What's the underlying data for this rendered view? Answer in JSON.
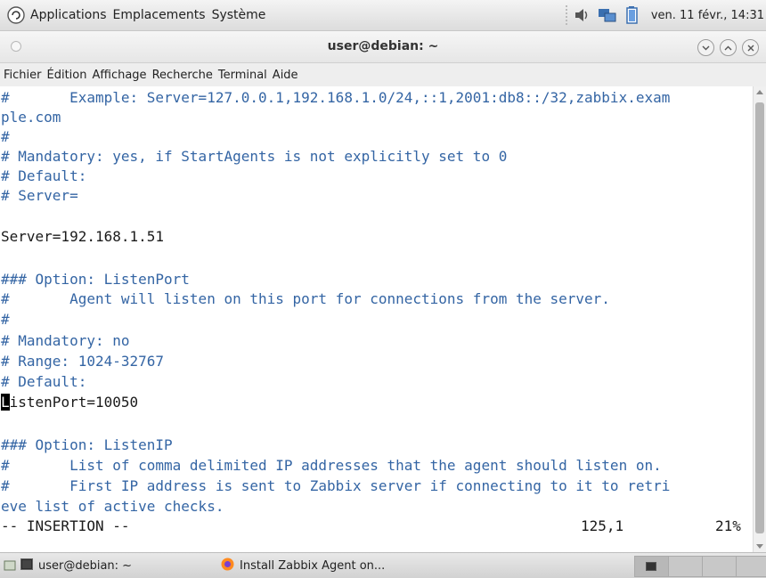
{
  "top_panel": {
    "menu": [
      "Applications",
      "Emplacements",
      "Système"
    ],
    "clock": "ven. 11 févr., 14:31"
  },
  "window": {
    "title": "user@debian: ~"
  },
  "menu_bar": [
    "Fichier",
    "Édition",
    "Affichage",
    "Recherche",
    "Terminal",
    "Aide"
  ],
  "terminal": {
    "lines": [
      "#       Example: Server=127.0.0.1,192.168.1.0/24,::1,2001:db8::/32,zabbix.exam",
      "ple.com",
      "#",
      "# Mandatory: yes, if StartAgents is not explicitly set to 0",
      "# Default:",
      "# Server=",
      "",
      "Server=192.168.1.51",
      "",
      "### Option: ListenPort",
      "#       Agent will listen on this port for connections from the server.",
      "#",
      "# Mandatory: no",
      "# Range: 1024-32767",
      "# Default:",
      "ListenPort=10050",
      "",
      "### Option: ListenIP",
      "#       List of comma delimited IP addresses that the agent should listen on.",
      "#       First IP address is sent to Zabbix server if connecting to it to retri",
      "eve list of active checks."
    ],
    "cursor_char": "L",
    "cursor_rest": "istenPort=10050",
    "status_mode": "-- INSERTION --",
    "status_pos": "125,1",
    "status_pct": "21%"
  },
  "taskbar": {
    "items": [
      "user@debian: ~",
      "Install Zabbix Agent on..."
    ]
  },
  "colors": {
    "comment": "#3465a4",
    "text": "#1a1a1a"
  }
}
